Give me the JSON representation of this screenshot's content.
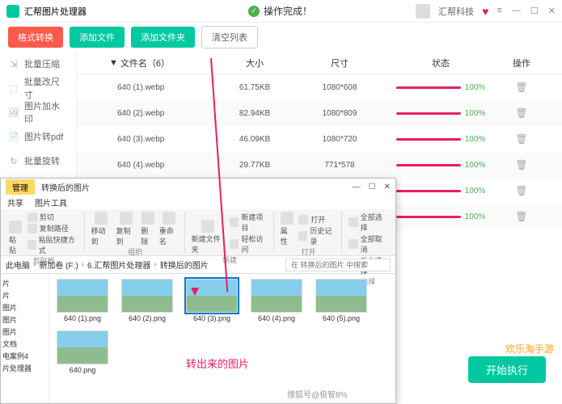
{
  "header": {
    "title": "汇帮图片处理器",
    "success": "操作完成！",
    "brand": "汇帮科技"
  },
  "toolbar": {
    "convert": "格式转换",
    "add_file": "添加文件",
    "add_folder": "添加文件夹",
    "clear": "清空列表"
  },
  "sidebar": {
    "items": [
      {
        "icon": "compress",
        "label": "批量压缩"
      },
      {
        "icon": "resize",
        "label": "批量改尺寸"
      },
      {
        "icon": "watermark",
        "label": "图片加水印"
      },
      {
        "icon": "pdf",
        "label": "图片转pdf"
      },
      {
        "icon": "rotate",
        "label": "批量旋转"
      }
    ]
  },
  "table": {
    "headers": {
      "name": "文件名（6）",
      "size": "大小",
      "dim": "尺寸",
      "status": "状态",
      "op": "操作"
    },
    "rows": [
      {
        "name": "640 (1).webp",
        "size": "61.75KB",
        "dim": "1080*608",
        "pct": "100%"
      },
      {
        "name": "640 (2).webp",
        "size": "82.94KB",
        "dim": "1080*809",
        "pct": "100%"
      },
      {
        "name": "640 (3).webp",
        "size": "46.09KB",
        "dim": "1080*720",
        "pct": "100%"
      },
      {
        "name": "640 (4).webp",
        "size": "29.77KB",
        "dim": "771*578",
        "pct": "100%"
      },
      {
        "name": "",
        "size": "",
        "dim": "",
        "pct": "100%"
      },
      {
        "name": "",
        "size": "",
        "dim": "",
        "pct": "100%"
      }
    ]
  },
  "explorer": {
    "tab_mgr": "管理",
    "tab_name": "转换后的图片",
    "menu": {
      "share": "共享",
      "tools": "图片工具"
    },
    "ribbon": {
      "clipboard": {
        "cut": "剪切",
        "copy_path": "复制路径",
        "paste_shortcut": "粘贴快捷方式",
        "paste": "粘贴",
        "label": "剪贴板"
      },
      "organize": {
        "move": "移动到",
        "copy": "复制到",
        "delete": "删除",
        "rename": "重命名",
        "label": "组织"
      },
      "new": {
        "item": "新建项目",
        "easy": "轻松访问",
        "folder": "新建文件夹",
        "label": "新建"
      },
      "open": {
        "props": "属性",
        "open": "打开",
        "history": "历史记录",
        "label": "打开"
      },
      "select": {
        "all": "全部选择",
        "none": "全部取消",
        "invert": "反向选择",
        "label": "选择"
      }
    },
    "breadcrumb": [
      "此电脑",
      "新加卷 (F:)",
      "6.汇帮图片处理器",
      "转换后的图片"
    ],
    "search_placeholder": "在 转换后的图片 中搜索",
    "side_items": [
      "片",
      "片",
      "图片",
      "图片",
      "图片",
      "文档",
      "电案例4",
      "片处理器"
    ],
    "files": [
      {
        "name": "640 (1).png"
      },
      {
        "name": "640 (2).png"
      },
      {
        "name": "640 (3).png"
      },
      {
        "name": "640 (4).png"
      },
      {
        "name": "640 (5).png"
      },
      {
        "name": "640.png"
      }
    ]
  },
  "annotation": "转出来的图片",
  "start_button": "开始执行",
  "watermark1": "欢乐淘手游",
  "watermark2": "搜狐号@极智8%"
}
